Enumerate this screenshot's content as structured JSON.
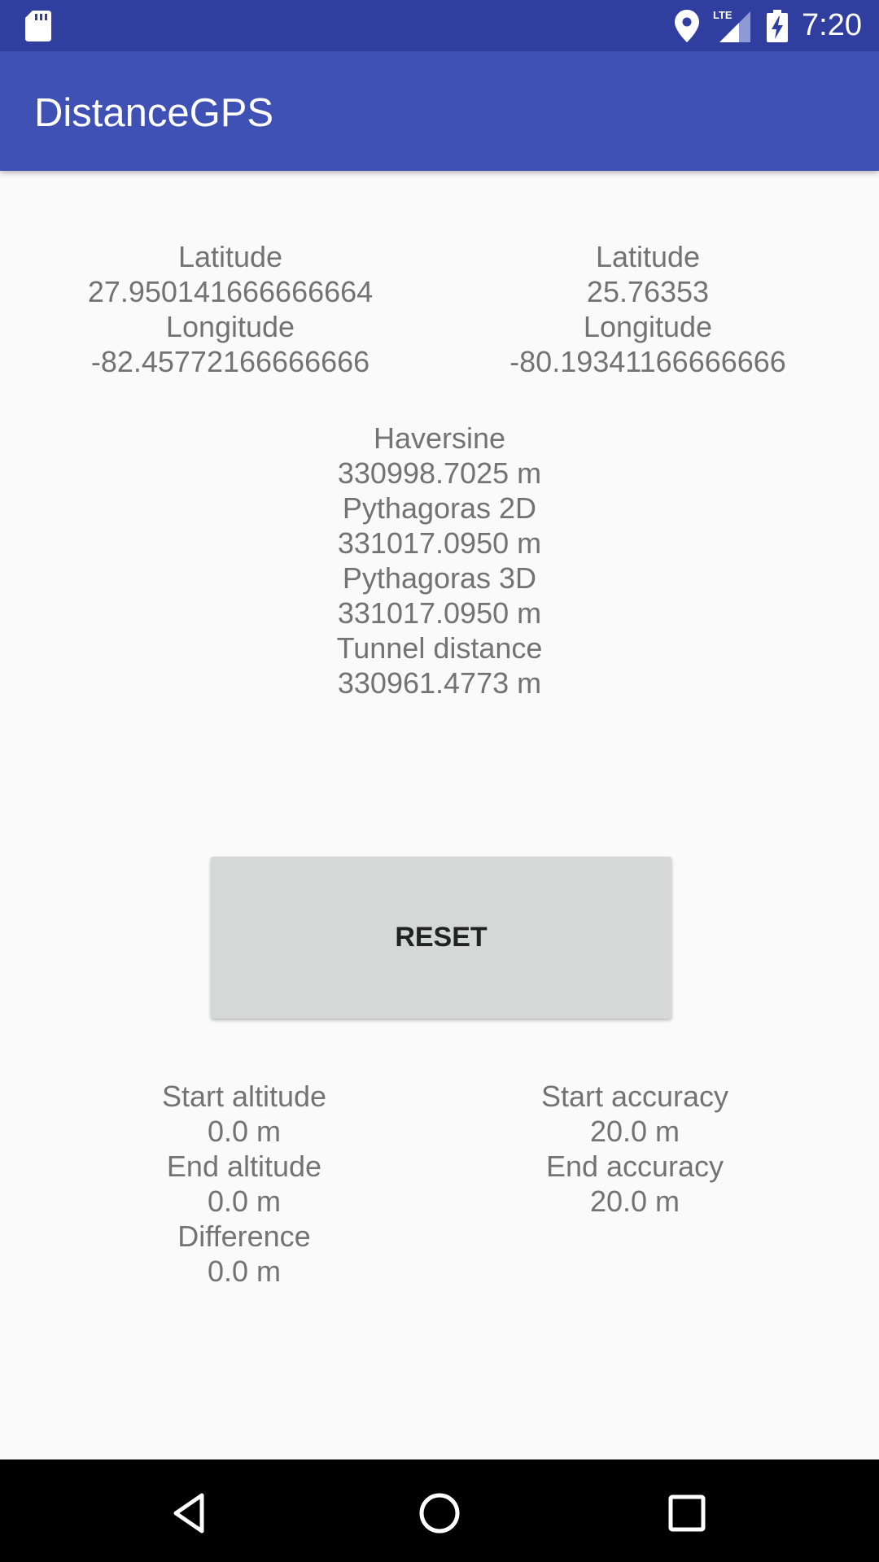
{
  "status_bar": {
    "time": "7:20",
    "icons": [
      "sd-card-icon",
      "location-icon",
      "lte-signal-icon",
      "battery-charging-icon"
    ],
    "lte_label": "LTE"
  },
  "app_bar": {
    "title": "DistanceGPS",
    "color": "#3f51b5",
    "status_color": "#303f9f"
  },
  "start_point": {
    "latitude_label": "Latitude",
    "latitude_value": "27.950141666666664",
    "longitude_label": "Longitude",
    "longitude_value": "-82.45772166666666"
  },
  "end_point": {
    "latitude_label": "Latitude",
    "latitude_value": "25.76353",
    "longitude_label": "Longitude",
    "longitude_value": "-80.19341166666666"
  },
  "distances": {
    "haversine_label": "Haversine",
    "haversine_value": "330998.7025 m",
    "pythagoras_2d_label": "Pythagoras 2D",
    "pythagoras_2d_value": "331017.0950 m",
    "pythagoras_3d_label": "Pythagoras 3D",
    "pythagoras_3d_value": "331017.0950 m",
    "tunnel_label": "Tunnel distance",
    "tunnel_value": "330961.4773 m"
  },
  "reset_button": {
    "label": "RESET"
  },
  "altitude": {
    "start_label": "Start altitude",
    "start_value": "0.0 m",
    "end_label": "End altitude",
    "end_value": "0.0 m",
    "difference_label": "Difference",
    "difference_value": "0.0 m"
  },
  "accuracy": {
    "start_label": "Start accuracy",
    "start_value": "20.0 m",
    "end_label": "End accuracy",
    "end_value": "20.0 m"
  },
  "nav_bar": {
    "icons": [
      "back-icon",
      "home-icon",
      "recents-icon"
    ]
  }
}
